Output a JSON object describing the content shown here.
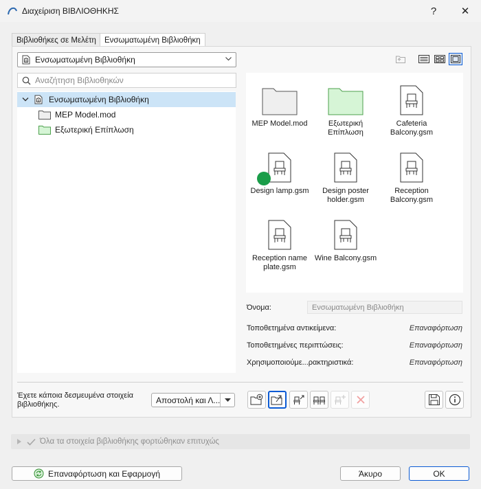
{
  "window": {
    "title": "Διαχείριση ΒΙΒΛΙΟΘΗΚΗΣ",
    "help_glyph": "?",
    "close_glyph": "✕"
  },
  "tabs": [
    {
      "label": "Βιβλιοθήκες σε Μελέτη",
      "active": false
    },
    {
      "label": "Ενσωματωμένη Βιβλιοθήκη",
      "active": true
    }
  ],
  "library_select": {
    "value": "Ενσωματωμένη Βιβλιοθήκη"
  },
  "search": {
    "placeholder": "Αναζήτηση Βιβλιοθηκών"
  },
  "tree": {
    "root": {
      "label": "Ενσωματωμένη Βιβλιοθήκη",
      "icon": "library-icon"
    },
    "children": [
      {
        "label": "MEP Model.mod",
        "icon": "folder-gray-icon"
      },
      {
        "label": "Εξωτερική Επίπλωση",
        "icon": "folder-green-icon"
      }
    ]
  },
  "grid_items": [
    {
      "label": "MEP Model.mod",
      "type": "folder-gray"
    },
    {
      "label": "Εξωτερική Επίπλωση",
      "type": "folder-green"
    },
    {
      "label": "Cafeteria Balcony.gsm",
      "type": "file"
    },
    {
      "label": "Design lamp.gsm",
      "type": "file",
      "status": "placed"
    },
    {
      "label": "Design poster holder.gsm",
      "type": "file"
    },
    {
      "label": "Reception Balcony.gsm",
      "type": "file"
    },
    {
      "label": "Reception name plate.gsm",
      "type": "file"
    },
    {
      "label": "Wine Balcony.gsm",
      "type": "file"
    }
  ],
  "properties": {
    "name_label": "Όνομα:",
    "name_value": "Ενσωματωμένη Βιβλιοθήκη",
    "rows": [
      {
        "label": "Τοποθετημένα αντικείμενα:",
        "value": "Επαναφόρτωση"
      },
      {
        "label": "Τοποθετημένες περιπτώσεις:",
        "value": "Επαναφόρτωση"
      },
      {
        "label": "Χρησιμοποιούμε...ρακτηριστικά:",
        "value": "Επαναφόρτωση"
      }
    ]
  },
  "reserved": {
    "message": "Έχετε κάποια δεσμευμένα στοιχεία βιβλιοθήκης.",
    "action_select": "Αποστολή και Λ..."
  },
  "status": {
    "message": "Όλα τα στοιχεία βιβλιοθήκης φορτώθηκαν επιτυχώς"
  },
  "footer": {
    "reload_label": "Επαναφόρτωση και Εφαρμογή",
    "cancel_label": "Άκυρο",
    "ok_label": "OK"
  },
  "colors": {
    "accent": "#0a5ad4",
    "selection": "#cce4f7",
    "green_folder": "#d6f5d6",
    "placed_dot": "#1a9d49"
  }
}
